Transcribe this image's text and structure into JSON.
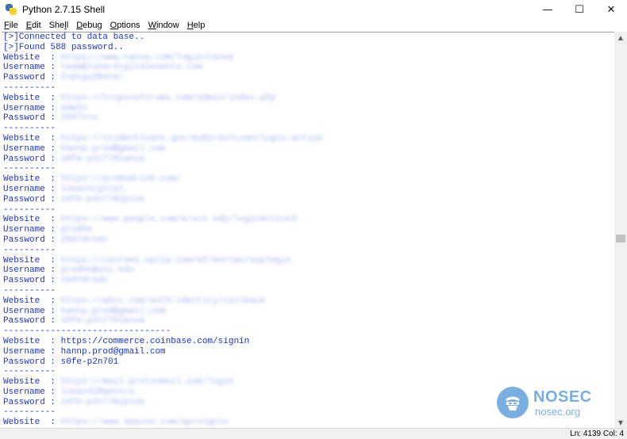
{
  "window": {
    "title": "Python 2.7.15 Shell",
    "controls": {
      "minimize": "—",
      "maximize": "☐",
      "close": "✕"
    }
  },
  "menu": [
    {
      "acc": "F",
      "rest": "ile"
    },
    {
      "acc": "E",
      "rest": "dit"
    },
    {
      "pre": "She",
      "acc": "l",
      "rest": "l"
    },
    {
      "acc": "D",
      "rest": "ebug"
    },
    {
      "acc": "O",
      "rest": "ptions"
    },
    {
      "acc": "W",
      "rest": "indow"
    },
    {
      "acc": "H",
      "rest": "elp"
    }
  ],
  "shell": {
    "header_lines": [
      "[>]Connected to data base..",
      "[>]Found 588 password.."
    ],
    "labels": {
      "website": "Website  : ",
      "username": "Username : ",
      "password": "Password : "
    },
    "separator_short": "----------",
    "separator_long": "--------------------------------",
    "records": [
      {
        "website": "https://www.canva.com/login/canva",
        "username": "team@lunardigitalevents.com",
        "password": "Indigo2B4te!",
        "blurred": true,
        "sep": "short"
      },
      {
        "website": "https://tropicoforums.com/admin/index.php",
        "username": "admin",
        "password": "2047tro",
        "blurred": true,
        "sep": "short"
      },
      {
        "website": "https://studentloans.gov/myDirectLoan/login.action",
        "username": "hannp.prod@gmail.com",
        "password": "s0fe-p2n7701anua",
        "blurred": true,
        "sep": "short"
      },
      {
        "website": "https://promodrink.com/",
        "username": "lunardigital",
        "password": "s0fe-p2n7701pine",
        "blurred": true,
        "sep": "short"
      },
      {
        "website": "https://www.people.com/a/uni.edu/loginAction2",
        "username": "prodhe",
        "password": "2047drodx",
        "blurred": true,
        "sep": "short"
      },
      {
        "website": "https://courses.uplia.com/ef/morten/ovplogin",
        "username": "prodhe@uni.edu",
        "password": "2047drodx",
        "blurred": true,
        "sep": "short"
      },
      {
        "website": "https://abcc.com/auth/identity/callback",
        "username": "hannp.prod@gmail.com",
        "password": "s0fe-p2n7701anua",
        "blurred": true,
        "sep": "long"
      },
      {
        "website": "https://commerce.coinbase.com/signin",
        "username": "hannp.prod@gmail.com",
        "password": "s0fe-p2n701",
        "blurred": false,
        "sep": "short"
      },
      {
        "website": "https://mail.protonmail.com/login",
        "username": "lunardiMaestro",
        "password": "s0fe-p2n7701pine",
        "blurred": true,
        "sep": "short"
      },
      {
        "website": "https://www.amazon.com/ap/signin",
        "blurred": true
      }
    ]
  },
  "status": {
    "text": "Ln: 4139   Col: 4"
  },
  "watermark": {
    "brand": "NOSEC",
    "url": "nosec.org"
  },
  "colors": {
    "shell_text": "#1c34c8",
    "watermark": "#7aaee0"
  }
}
